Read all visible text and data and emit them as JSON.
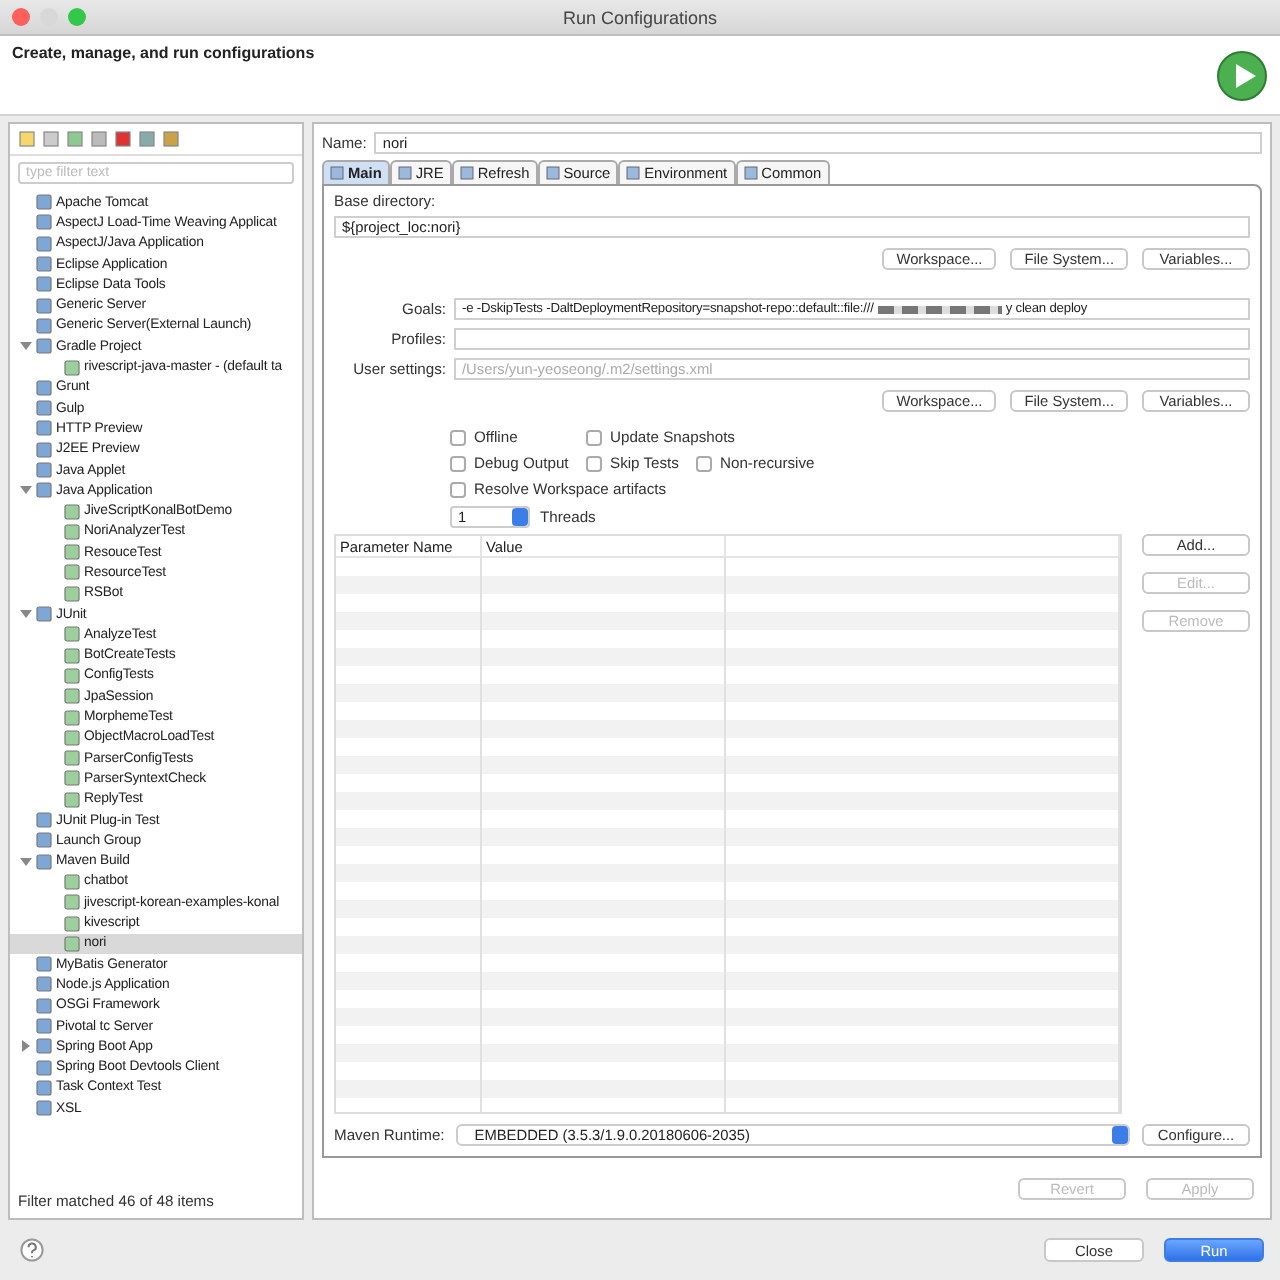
{
  "window": {
    "title": "Run Configurations"
  },
  "header": {
    "title": "Create, manage, and run configurations"
  },
  "sidebar": {
    "filter": {
      "placeholder": "type filter text"
    },
    "tree": [
      {
        "label": "Apache Tomcat"
      },
      {
        "label": "AspectJ Load-Time Weaving Applicat"
      },
      {
        "label": "AspectJ/Java Application"
      },
      {
        "label": "Eclipse Application"
      },
      {
        "label": "Eclipse Data Tools"
      },
      {
        "label": "Generic Server"
      },
      {
        "label": "Generic Server(External Launch)"
      },
      {
        "label": "Gradle Project",
        "expanded": true,
        "children": [
          {
            "label": "rivescript-java-master - (default ta"
          }
        ]
      },
      {
        "label": "Grunt"
      },
      {
        "label": "Gulp"
      },
      {
        "label": "HTTP Preview"
      },
      {
        "label": "J2EE Preview"
      },
      {
        "label": "Java Applet"
      },
      {
        "label": "Java Application",
        "expanded": true,
        "children": [
          {
            "label": "JiveScriptKonalBotDemo"
          },
          {
            "label": "NoriAnalyzerTest"
          },
          {
            "label": "ResouceTest"
          },
          {
            "label": "ResourceTest"
          },
          {
            "label": "RSBot"
          }
        ]
      },
      {
        "label": "JUnit",
        "expanded": true,
        "children": [
          {
            "label": "AnalyzeTest"
          },
          {
            "label": "BotCreateTests"
          },
          {
            "label": "ConfigTests"
          },
          {
            "label": "JpaSession"
          },
          {
            "label": "MorphemeTest"
          },
          {
            "label": "ObjectMacroLoadTest"
          },
          {
            "label": "ParserConfigTests"
          },
          {
            "label": "ParserSyntextCheck"
          },
          {
            "label": "ReplyTest"
          }
        ]
      },
      {
        "label": "JUnit Plug-in Test"
      },
      {
        "label": "Launch Group"
      },
      {
        "label": "Maven Build",
        "expanded": true,
        "children": [
          {
            "label": "chatbot",
            "selected": false
          },
          {
            "label": "jivescript-korean-examples-konal",
            "selected": false
          },
          {
            "label": "kivescript",
            "selected": false
          },
          {
            "label": "nori",
            "selected": true
          }
        ]
      },
      {
        "label": "MyBatis Generator"
      },
      {
        "label": "Node.js Application"
      },
      {
        "label": "OSGi Framework"
      },
      {
        "label": "Pivotal tc Server"
      },
      {
        "label": "Spring Boot App",
        "expanded": false
      },
      {
        "label": "Spring Boot Devtools Client"
      },
      {
        "label": "Task Context Test"
      },
      {
        "label": "XSL"
      }
    ],
    "status": "Filter matched 46 of 48 items"
  },
  "name": {
    "label": "Name:",
    "value": "nori"
  },
  "tabs": [
    {
      "label": "Main",
      "selected": true
    },
    {
      "label": "JRE",
      "selected": false
    },
    {
      "label": "Refresh",
      "selected": false
    },
    {
      "label": "Source",
      "selected": false
    },
    {
      "label": "Environment",
      "selected": false
    },
    {
      "label": "Common",
      "selected": false
    }
  ],
  "main": {
    "base_directory": {
      "label": "Base directory:",
      "value": "${project_loc:nori}"
    },
    "dir_buttons": [
      "Workspace...",
      "File System...",
      "Variables..."
    ],
    "goals": {
      "label": "Goals:",
      "value_start": "-e -DskipTests -DaltDeploymentRepository=snapshot-repo::default::file:///",
      "value_end": "y clean deploy"
    },
    "profiles": {
      "label": "Profiles:"
    },
    "user_settings": {
      "label": "User settings:",
      "value": "/Users/yun-yeoseong/.m2/settings.xml",
      "disabled": true
    },
    "settings_buttons": [
      "Workspace...",
      "File System...",
      "Variables..."
    ],
    "option_rows": [
      [
        {
          "label": "Offline",
          "checked": false
        },
        {
          "label": "Update Snapshots",
          "checked": false
        }
      ],
      [
        {
          "label": "Debug Output",
          "checked": false
        },
        {
          "label": "Skip Tests",
          "checked": false
        },
        {
          "label": "Non-recursive",
          "checked": false
        }
      ],
      [
        {
          "label": "Resolve Workspace artifacts",
          "checked": false
        }
      ]
    ],
    "threads": {
      "value": "1",
      "label": "Threads"
    },
    "table": {
      "columns": [
        "Parameter Name",
        "Value"
      ]
    },
    "table_buttons": [
      {
        "label": "Add...",
        "disabled": false
      },
      {
        "label": "Edit...",
        "disabled": true
      },
      {
        "label": "Remove",
        "disabled": true
      }
    ],
    "maven_runtime": {
      "label": "Maven Runtime:",
      "value": "EMBEDDED (3.5.3/1.9.0.20180606-2035)"
    },
    "configure": "Configure..."
  },
  "apply_buttons": [
    {
      "label": "Revert",
      "disabled": true
    },
    {
      "label": "Apply",
      "disabled": true
    }
  ],
  "dialog_buttons": [
    {
      "label": "Close",
      "kind": "default"
    },
    {
      "label": "Run",
      "kind": "primary"
    }
  ]
}
